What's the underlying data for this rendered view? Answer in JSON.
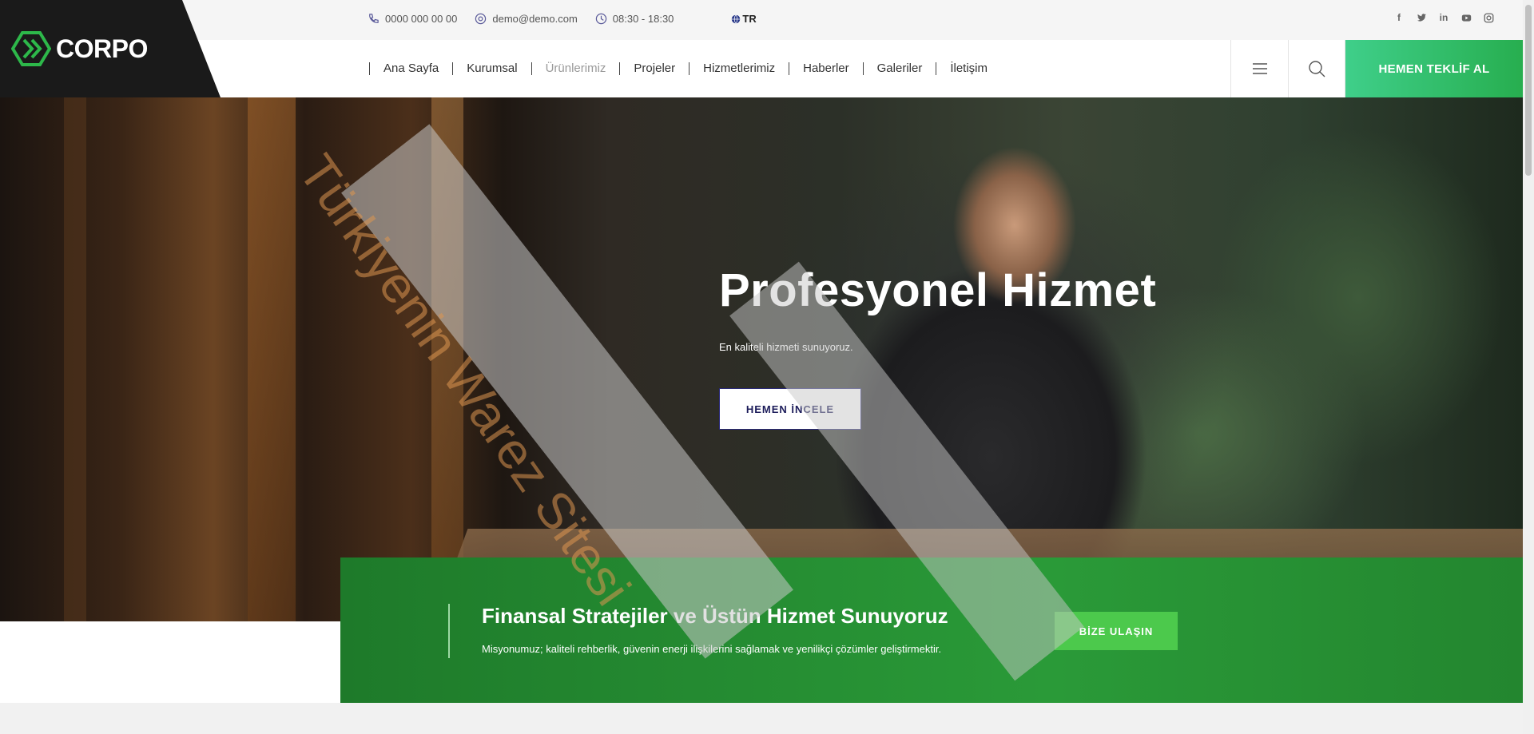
{
  "brand": {
    "name": "CORPO",
    "accent": "#2db84a"
  },
  "topbar": {
    "phone": "0000 000 00 00",
    "email": "demo@demo.com",
    "hours": "08:30 - 18:30",
    "language": "TR",
    "socials": [
      "facebook-icon",
      "twitter-icon",
      "linkedin-icon",
      "youtube-icon",
      "instagram-icon"
    ]
  },
  "nav": {
    "items": [
      "Ana Sayfa",
      "Kurumsal",
      "Ürünlerimiz",
      "Projeler",
      "Hizmetlerimiz",
      "Haberler",
      "Galeriler",
      "İletişim"
    ],
    "cta": "HEMEN TEKLİF AL"
  },
  "hero": {
    "title": "Profesyonel Hizmet",
    "subtitle": "En kaliteli hizmeti sunuyoruz.",
    "button": "HEMEN İNCELE"
  },
  "callout": {
    "title": "Finansal Stratejiler ve Üstün Hizmet Sunuyoruz",
    "text": "Misyonumuz; kaliteli rehberlik, güvenin enerji ilişkilerini sağlamak ve yenilikçi çözümler geliştirmektir.",
    "button": "BİZE ULAŞIN"
  },
  "watermark": {
    "text": "Türkiyenin Warez Sitesi"
  }
}
